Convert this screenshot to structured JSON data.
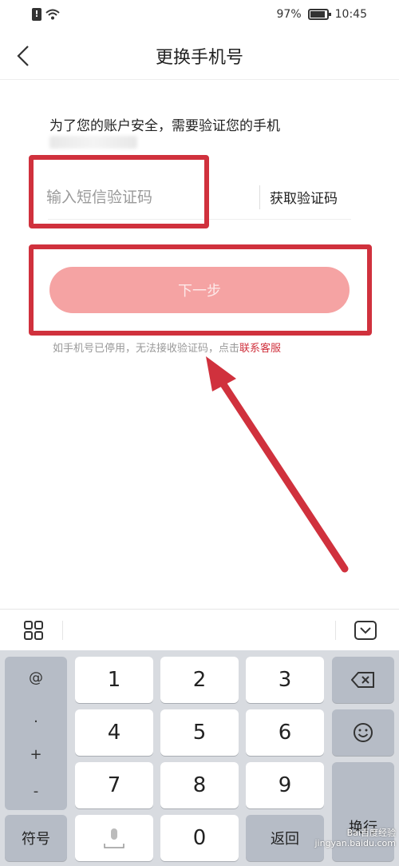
{
  "status_bar": {
    "sim_label": "!",
    "battery_percent": "97%",
    "time": "10:45"
  },
  "header": {
    "title": "更换手机号"
  },
  "form": {
    "hint": "为了您的账户安全，需要验证您的手机",
    "code_placeholder": "输入短信验证码",
    "get_code_label": "获取验证码",
    "next_label": "下一步",
    "help_prefix": "如手机号已停用，无法接收验证码，点击",
    "help_link": "联系客服"
  },
  "annotation_color": "#d0313d",
  "keyboard": {
    "symbols": [
      "@",
      ".",
      "+",
      "-"
    ],
    "digits_row1": [
      "1",
      "2",
      "3"
    ],
    "digits_row2": [
      "4",
      "5",
      "6"
    ],
    "digits_row3": [
      "7",
      "8",
      "9"
    ],
    "symbols_key": "符号",
    "zero_key": "0",
    "back_key": "返回",
    "enter_key": "换行"
  },
  "watermark": "Bai百度经验 jingyan.baidu.com"
}
